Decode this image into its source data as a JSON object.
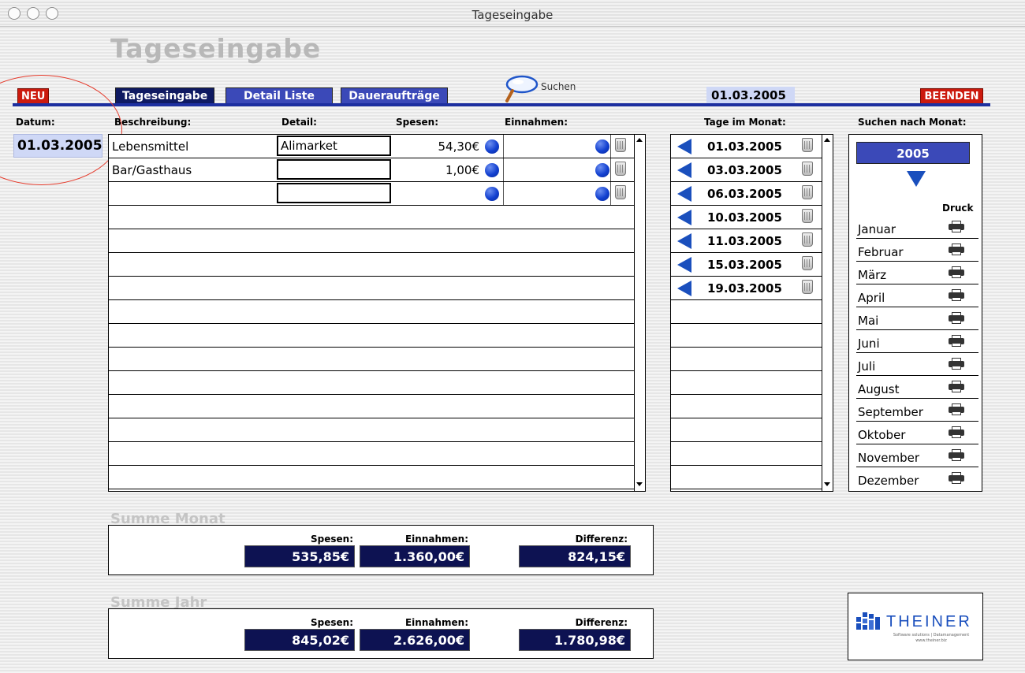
{
  "window": {
    "title": "Tageseingabe"
  },
  "page_title": "Tageseingabe",
  "toolbar": {
    "neu": "NEU",
    "beenden": "BEENDEN",
    "suchen": "Suchen",
    "current_date": "01.03.2005"
  },
  "tabs": [
    "Tageseingabe",
    "Detail Liste",
    "Daueraufträge"
  ],
  "datum": {
    "label": "Datum:",
    "value": "01.03.2005"
  },
  "entries": {
    "headers": {
      "beschreibung": "Beschreibung:",
      "detail": "Detail:",
      "spesen": "Spesen:",
      "einnahmen": "Einnahmen:"
    },
    "rows": [
      {
        "beschreibung": "Lebensmittel",
        "detail": "Alimarket",
        "spesen": "54,30€",
        "einnahmen": ""
      },
      {
        "beschreibung": "Bar/Gasthaus",
        "detail": "",
        "spesen": "1,00€",
        "einnahmen": ""
      },
      {
        "beschreibung": "",
        "detail": "",
        "spesen": "",
        "einnahmen": ""
      }
    ]
  },
  "days": {
    "header": "Tage im Monat:",
    "items": [
      "01.03.2005",
      "03.03.2005",
      "06.03.2005",
      "10.03.2005",
      "11.03.2005",
      "15.03.2005",
      "19.03.2005"
    ]
  },
  "months": {
    "header": "Suchen nach Monat:",
    "year": "2005",
    "druck": "Druck",
    "items": [
      "Januar",
      "Februar",
      "März",
      "April",
      "Mai",
      "Juni",
      "Juli",
      "August",
      "September",
      "Oktober",
      "November",
      "Dezember"
    ]
  },
  "summe_monat": {
    "title": "Summe Monat",
    "spesen_label": "Spesen:",
    "einnahmen_label": "Einnahmen:",
    "differenz_label": "Differenz:",
    "spesen": "535,85€",
    "einnahmen": "1.360,00€",
    "differenz": "824,15€"
  },
  "summe_jahr": {
    "title": "Summe Jahr",
    "spesen_label": "Spesen:",
    "einnahmen_label": "Einnahmen:",
    "differenz_label": "Differenz:",
    "spesen": "845,02€",
    "einnahmen": "2.626,00€",
    "differenz": "1.780,98€"
  },
  "logo": {
    "name": "THEINER",
    "sub": "Software solutions | Datamanagement",
    "url": "www.theiner.biz"
  },
  "colors": {
    "accent_blue": "#1d2fa0",
    "tab_active": "#0f1a62",
    "tab_inactive": "#3b49b8",
    "red_button": "#cc1a0e",
    "date_highlight": "#cfd8f6",
    "sum_value_bg": "#0d1252",
    "annotation_circle": "#e53b2c"
  }
}
